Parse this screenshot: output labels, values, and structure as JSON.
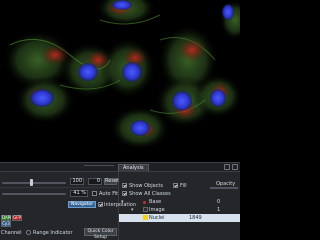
{
  "viewer": {
    "title": "Fluorescence image of cells (DAPI nuclei, green cytoskeleton, red mitochondria)"
  },
  "panel": {
    "analysis_tab": "Analysis"
  },
  "display": {
    "value_field": "100",
    "value_field2": "0",
    "reset_label": "Reset",
    "gamma_field": "41 %",
    "auto_fit_label": "Auto Fit",
    "navigator_label": "Navigator",
    "interpolation_label": "Interpolation",
    "channel_btn_1": "DAPI",
    "channel_btn_2": "GFP",
    "channel_btn_3": "Cy3",
    "channel_label": "Channel",
    "range_indicator_label": "Range Indicator",
    "quick_color_setup_label": "Quick Color Setup"
  },
  "analysis": {
    "show_objects_label": "Show Objects",
    "show_all_classes_label": "Show All Classes",
    "fill_label": "Fill",
    "opacity_label": "Opacity",
    "tree": [
      {
        "label": "Base",
        "value": "0"
      },
      {
        "label": "Image",
        "value": "1"
      },
      {
        "label": "Nuclei",
        "value": "1849"
      }
    ]
  },
  "colors": {
    "accent": "#2f5d8c",
    "selected_row": "#d7e2ee",
    "nuclei_swatch": "#f4d21a"
  }
}
